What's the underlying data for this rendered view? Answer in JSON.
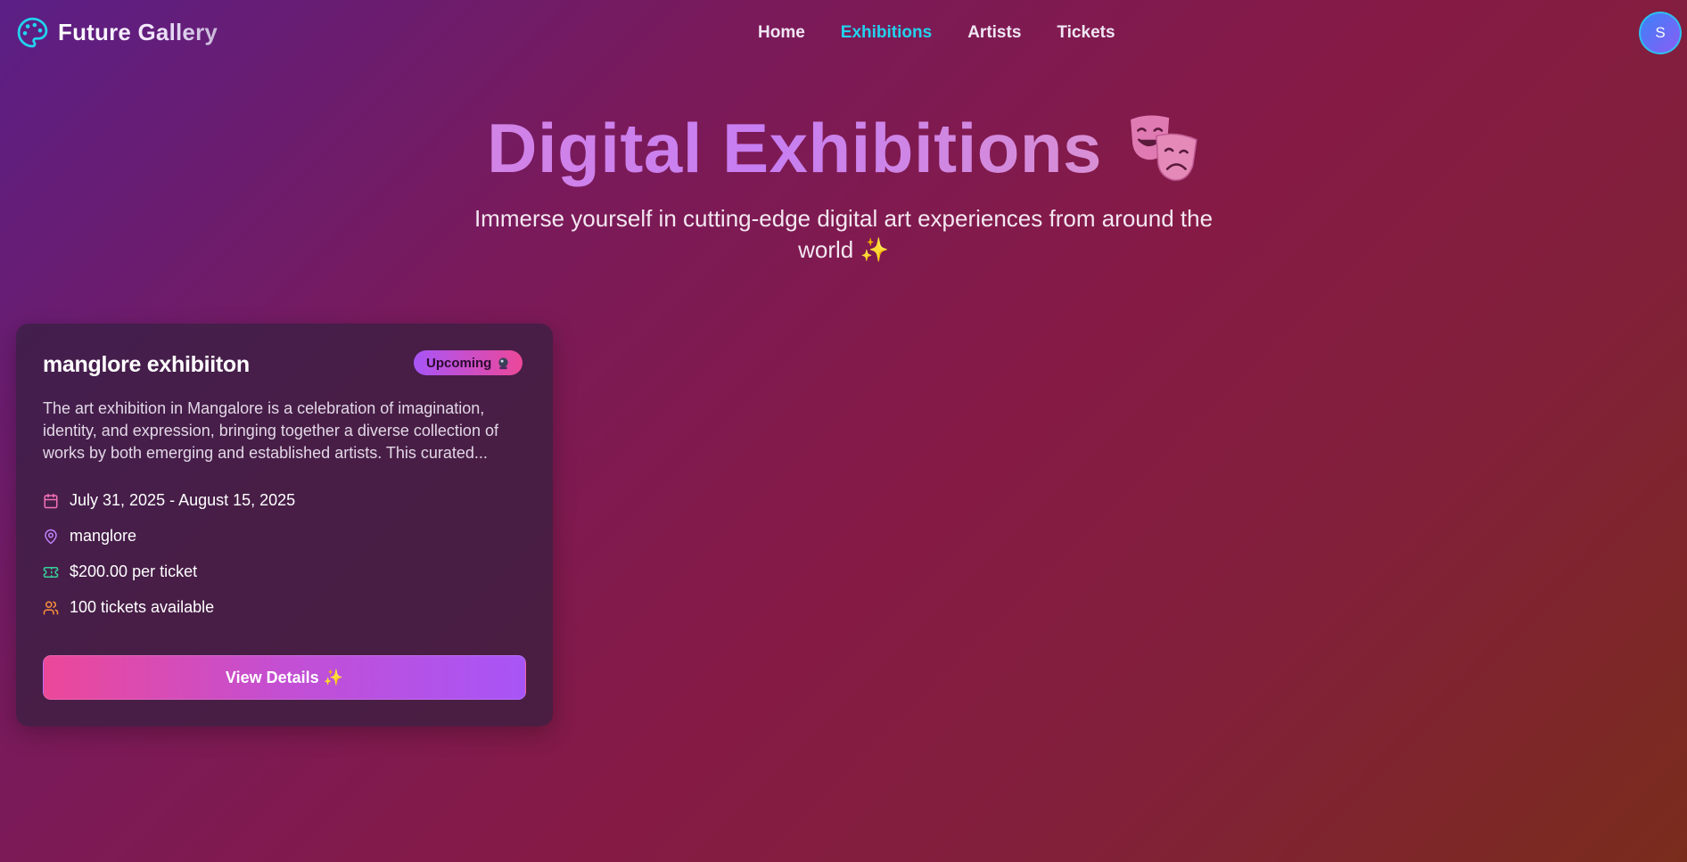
{
  "header": {
    "logo_text": "Future Gallery",
    "nav": [
      {
        "label": "Home"
      },
      {
        "label": "Exhibitions",
        "active": true
      },
      {
        "label": "Artists"
      },
      {
        "label": "Tickets"
      }
    ],
    "avatar_initial": "S"
  },
  "hero": {
    "title": "Digital Exhibitions",
    "title_icon": "theater-masks-icon",
    "subtitle": "Immerse yourself in cutting-edge digital art experiences from around the world ✨"
  },
  "card": {
    "title": "manglore exhibiiton",
    "badge": "Upcoming",
    "badge_icon": "crystal-ball-icon",
    "description": "The art exhibition in Mangalore is a celebration of imagination, identity, and expression, bringing together a diverse collection of works by both emerging and established artists. This curated...",
    "dates": "July 31, 2025 - August 15, 2025",
    "location": "manglore",
    "price": "$200.00 per ticket",
    "tickets": "100 tickets available",
    "button_label": "View Details ✨"
  },
  "colors": {
    "accent_cyan": "#22d3ee",
    "pink": "#ec4899",
    "purple": "#a855f7",
    "calendar_icon": "#f472b6",
    "location_icon": "#c084fc",
    "ticket_icon": "#34d399",
    "users_icon": "#fb923c"
  }
}
